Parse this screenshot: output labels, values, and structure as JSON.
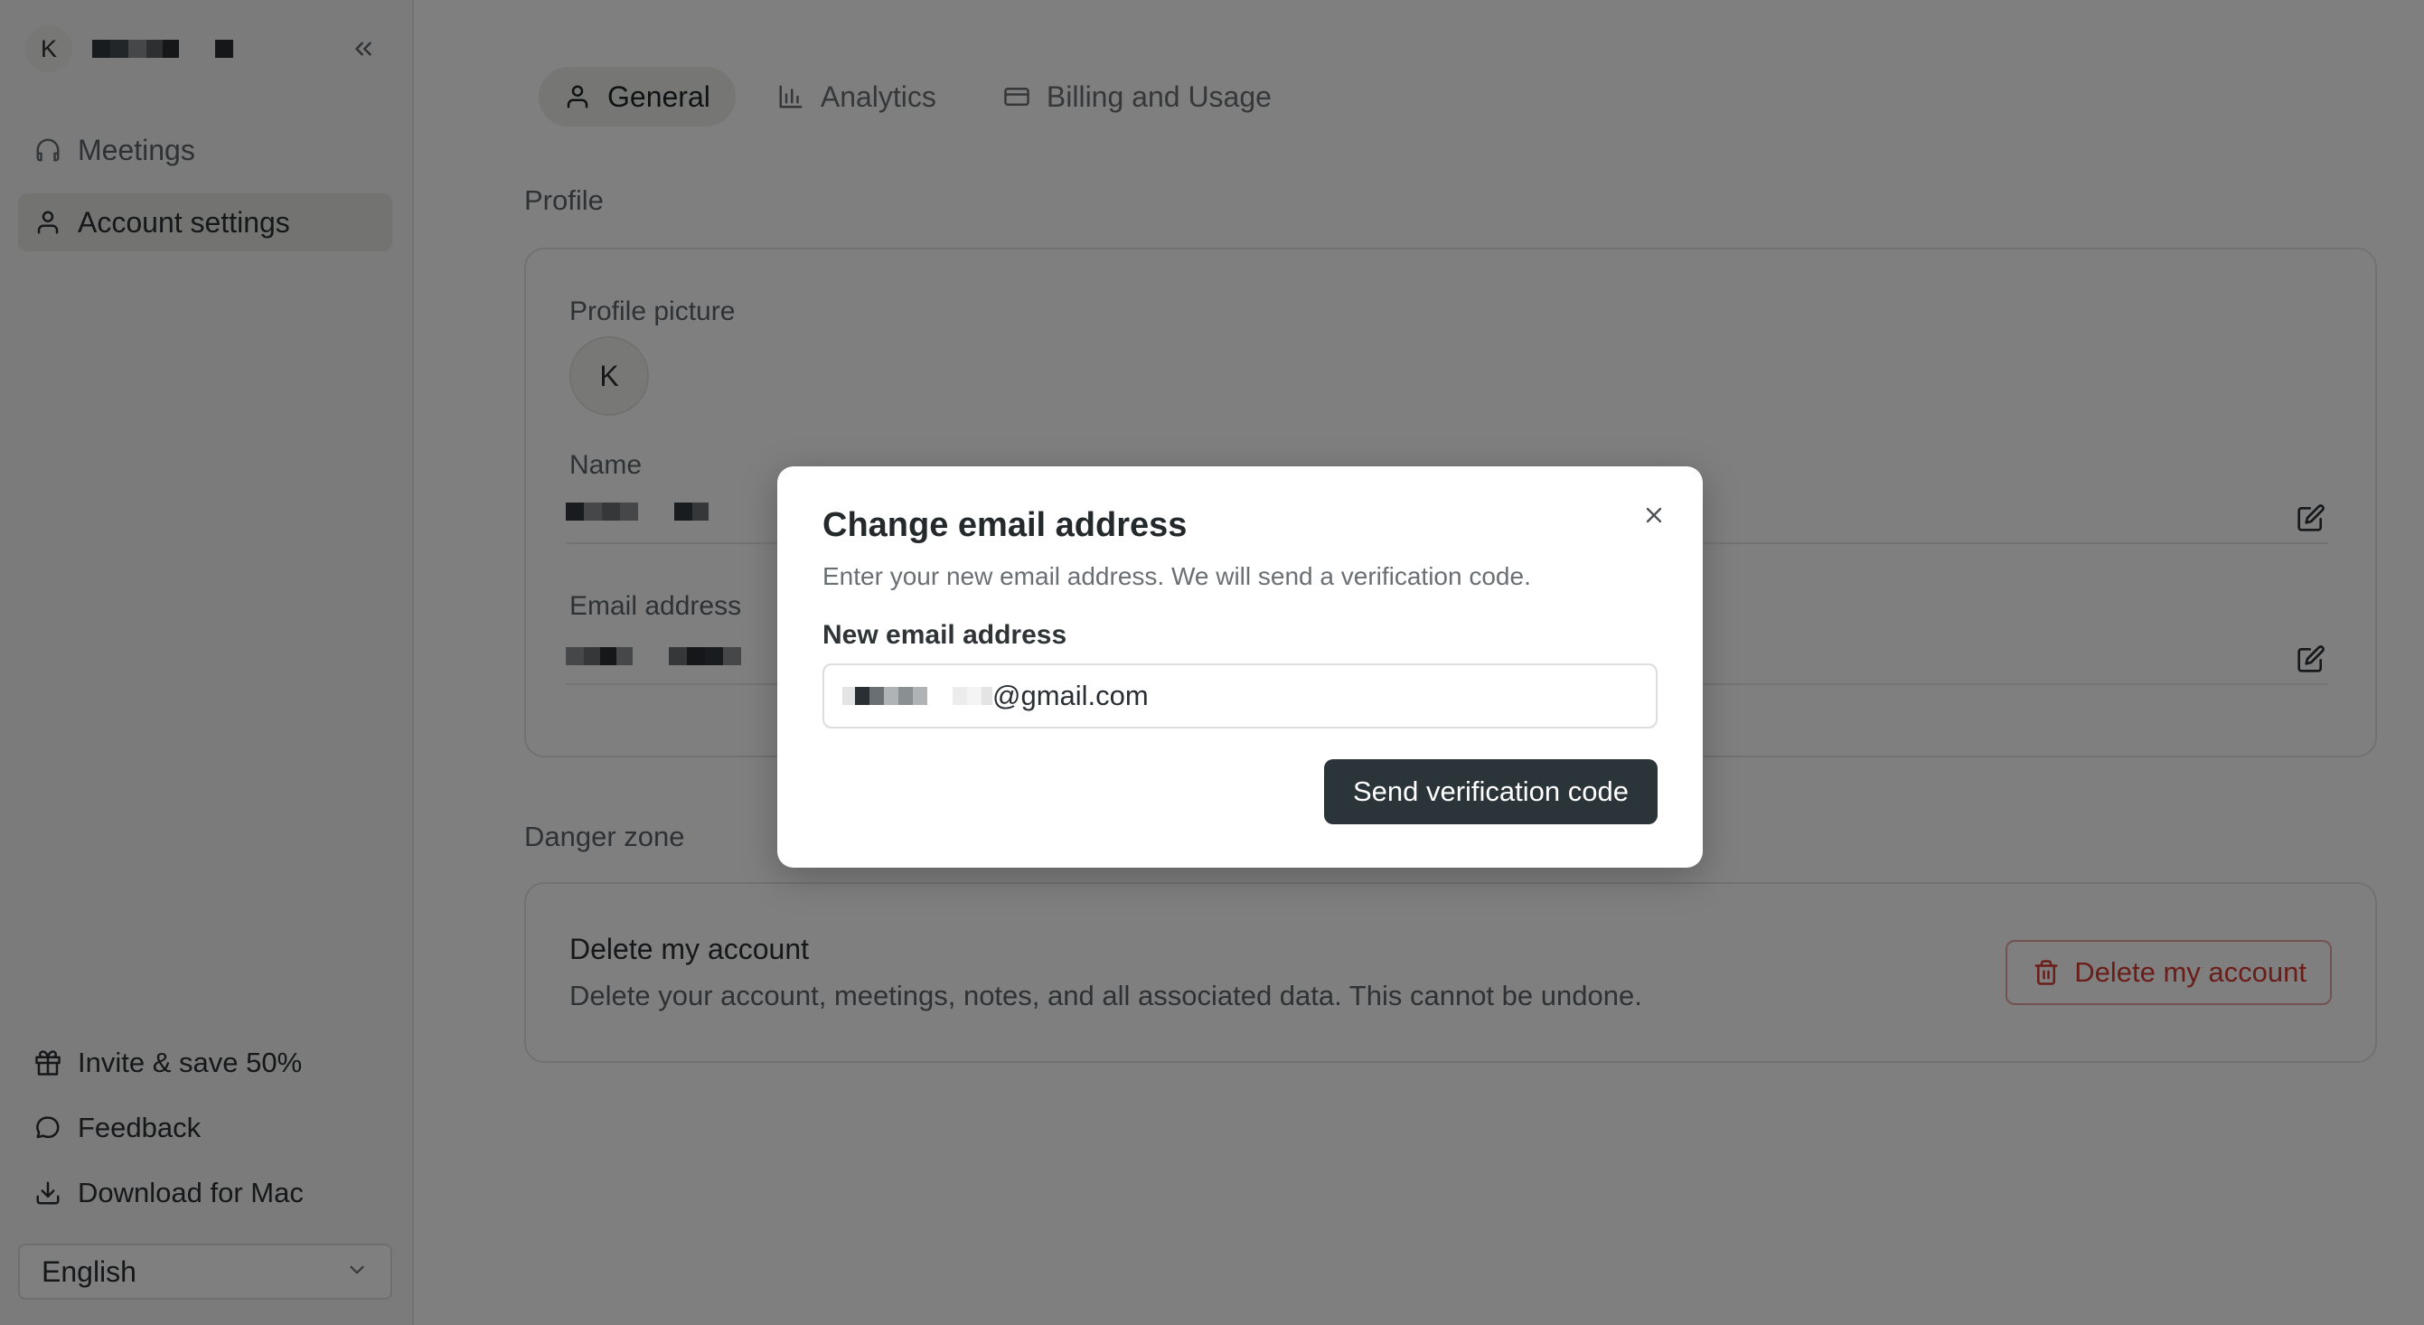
{
  "sidebar": {
    "workspace_initial": "K",
    "nav": [
      {
        "label": "Meetings",
        "icon": "headphones-icon"
      },
      {
        "label": "Account settings",
        "icon": "user-icon"
      }
    ],
    "bottom": [
      {
        "label": "Invite & save 50%",
        "icon": "gift-icon"
      },
      {
        "label": "Feedback",
        "icon": "message-icon"
      },
      {
        "label": "Download for Mac",
        "icon": "download-icon"
      }
    ],
    "language": "English"
  },
  "tabs": [
    {
      "label": "General",
      "icon": "user-icon"
    },
    {
      "label": "Analytics",
      "icon": "bar-chart-icon"
    },
    {
      "label": "Billing and Usage",
      "icon": "credit-card-icon"
    }
  ],
  "profile": {
    "section_label": "Profile",
    "picture_label": "Profile picture",
    "avatar_initial": "K",
    "name_label": "Name",
    "email_label": "Email address"
  },
  "danger": {
    "section_label": "Danger zone",
    "title": "Delete my account",
    "description": "Delete your account, meetings, notes, and all associated data. This cannot be undone.",
    "button_label": "Delete my account"
  },
  "modal": {
    "title": "Change email address",
    "subtitle": "Enter your new email address. We will send a verification code.",
    "field_label": "New email address",
    "input_suffix": "@gmail.com",
    "submit_label": "Send verification code"
  },
  "colors": {
    "accent_dark": "#2b3438",
    "danger": "#d43a32",
    "overlay": "rgba(0,0,0,0.5)"
  }
}
